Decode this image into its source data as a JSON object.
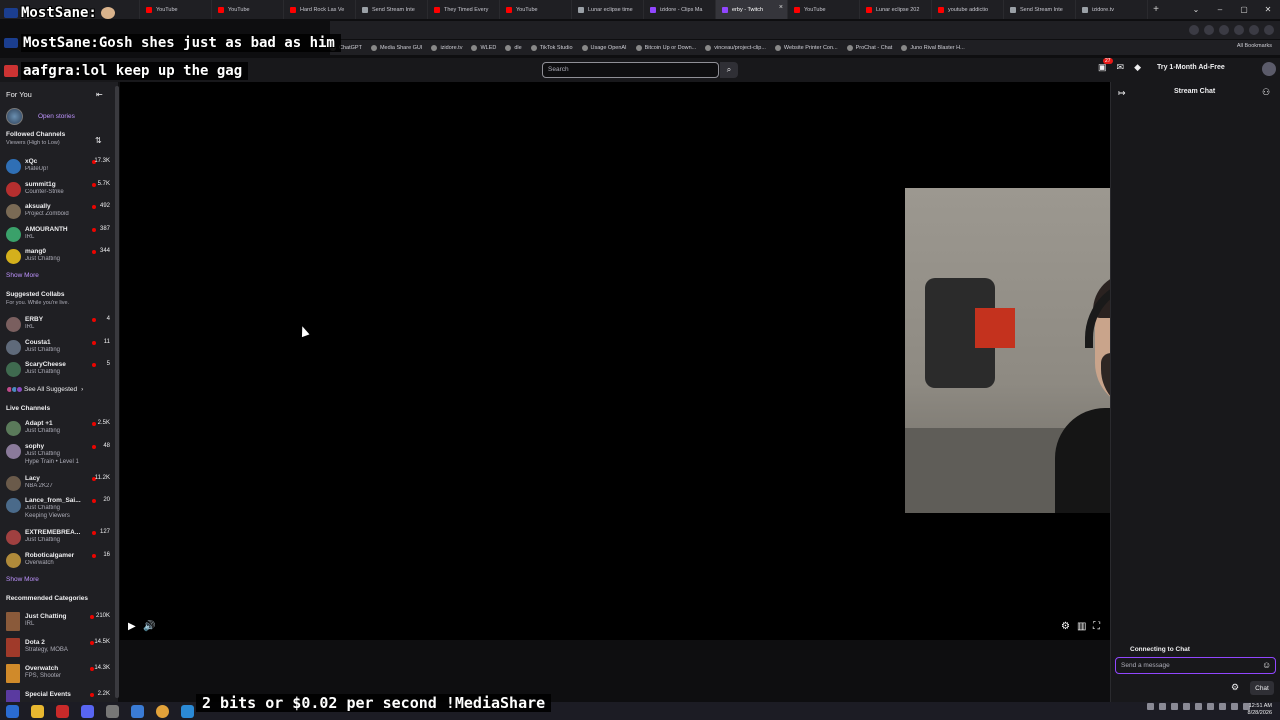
{
  "browser": {
    "tabs": [
      {
        "label": "YouTube",
        "color": "#ff0000"
      },
      {
        "label": "YouTube",
        "color": "#ff0000"
      },
      {
        "label": "Hard Rock Las Ve",
        "color": "#ff0000"
      },
      {
        "label": "Send Stream Inte",
        "color": "#9aa0a6"
      },
      {
        "label": "They Timed Every",
        "color": "#ff0000"
      },
      {
        "label": "YouTube",
        "color": "#ff0000"
      },
      {
        "label": "Lunar eclipse time",
        "color": "#9aa0a6"
      },
      {
        "label": "izidore - Clips Ma",
        "color": "#9146ff"
      },
      {
        "label": "erby - Twitch",
        "color": "#9146ff",
        "active": true
      },
      {
        "label": "YouTube",
        "color": "#ff0000"
      },
      {
        "label": "Lunar eclipse 202",
        "color": "#ff0000"
      },
      {
        "label": "youtube addictio",
        "color": "#ff0000"
      },
      {
        "label": "Send Stream Inte",
        "color": "#9aa0a6"
      },
      {
        "label": "izidore.tv",
        "color": "#9aa0a6"
      }
    ],
    "bookmarks": [
      "ChatGPT",
      "Media Share GUI",
      "izidore.tv",
      "WLED",
      "dle",
      "TikTok Studio",
      "Usage OpenAI",
      "Bitcoin Up or Down...",
      "vinceau/project-clip...",
      "Website Printer Con...",
      "ProChat - Chat",
      "Juno Rival Blaster H..."
    ],
    "all_bookmarks": "All Bookmarks"
  },
  "overlay": {
    "line1_name": "MostSane:",
    "line2_name": "MostSane:",
    "line2_msg": "Gosh shes just as bad as him",
    "line3_name": "aafgra:",
    "line3_msg": "lol keep up the gag",
    "ticker": "2 bits or $0.02 per second !MediaShare"
  },
  "nav": {
    "search_placeholder": "Search",
    "notifications": "27",
    "ad_free": "Try 1-Month Ad-Free"
  },
  "sidebar": {
    "for_you": "For You",
    "open_stories": "Open stories",
    "followed_title": "Followed Channels",
    "followed_sub": "Viewers (High to Low)",
    "followed": [
      {
        "name": "xQc",
        "game": "PlateUp!",
        "viewers": "17.3K",
        "color": "#2f6fb5"
      },
      {
        "name": "summit1g",
        "game": "Counter-Strike",
        "viewers": "5.7K",
        "color": "#b52f2f"
      },
      {
        "name": "aksually",
        "game": "Project Zomboid",
        "viewers": "492",
        "color": "#7a6a55"
      },
      {
        "name": "AMOURANTH",
        "game": "IRL",
        "viewers": "387",
        "color": "#3aa16a"
      },
      {
        "name": "mang0",
        "game": "Just Chatting",
        "viewers": "344",
        "color": "#d4b01c"
      }
    ],
    "show_more_1": "Show More",
    "collabs_title": "Suggested Collabs",
    "collabs_sub": "For you. While you're live.",
    "collabs": [
      {
        "name": "ERBY",
        "game": "IRL",
        "viewers": "4",
        "color": "#7a5f5f"
      },
      {
        "name": "Cousta1",
        "game": "Just Chatting",
        "viewers": "11",
        "color": "#5f6a7a"
      },
      {
        "name": "ScaryCheese",
        "game": "Just Chatting",
        "viewers": "5",
        "color": "#3f6a4f"
      }
    ],
    "see_all": "See All Suggested",
    "live_title": "Live Channels",
    "live": [
      {
        "name": "Adapt +1",
        "game": "Just Chatting",
        "viewers": "2.5K",
        "color": "#5a7a5a"
      },
      {
        "name": "sophy",
        "game": "Just Chatting",
        "extra": "Hype Train • Level 1",
        "viewers": "48",
        "color": "#8a7a9a"
      },
      {
        "name": "Lacy",
        "game": "NBA 2K27",
        "viewers": "11.2K",
        "color": "#6a5a4a"
      },
      {
        "name": "Lance_from_Sai...",
        "game": "Just Chatting",
        "extra": "Keeping Viewers",
        "viewers": "20",
        "color": "#4a6a8a"
      },
      {
        "name": "EXTREMEBREA...",
        "game": "Just Chatting",
        "viewers": "127",
        "color": "#a04040"
      },
      {
        "name": "Roboticalgamer",
        "game": "Overwatch",
        "viewers": "16",
        "color": "#b08a3a"
      }
    ],
    "show_more_2": "Show More",
    "categories_title": "Recommended Categories",
    "categories": [
      {
        "name": "Just Chatting",
        "tags": "IRL",
        "viewers": "210K",
        "color": "#8a5a3a"
      },
      {
        "name": "Dota 2",
        "tags": "Strategy, MOBA",
        "viewers": "14.5K",
        "color": "#a03a2a"
      },
      {
        "name": "Overwatch",
        "tags": "FPS, Shooter",
        "viewers": "14.3K",
        "color": "#d08a2a"
      },
      {
        "name": "Special Events",
        "tags": "",
        "viewers": "2.2K",
        "color": "#5a3aa0"
      }
    ]
  },
  "chat": {
    "title": "Stream Chat",
    "connecting": "Connecting to Chat",
    "input_placeholder": "Send a message",
    "chat_button": "Chat"
  },
  "clock": {
    "time": "12:51 AM",
    "date": "8/28/2026"
  }
}
